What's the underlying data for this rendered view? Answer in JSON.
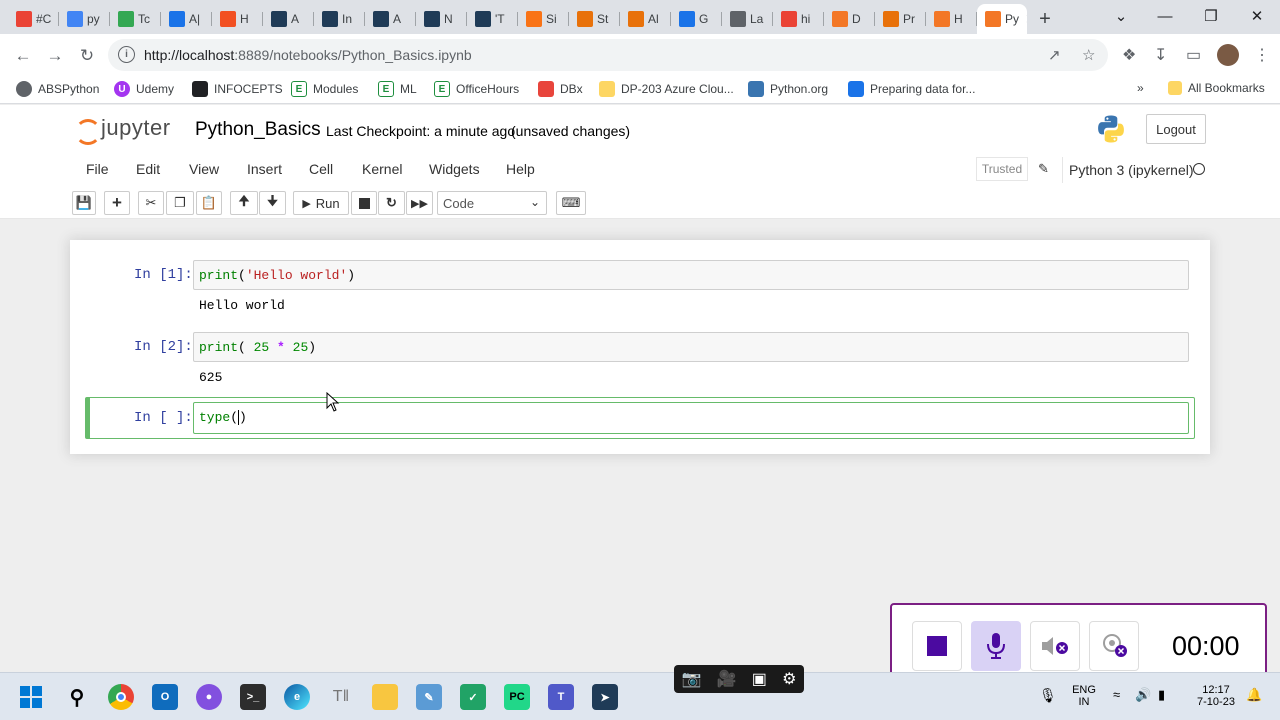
{
  "browser": {
    "tabs": [
      {
        "label": "#C",
        "icon": "gmail-icon",
        "color": "#ea4335"
      },
      {
        "label": "py",
        "icon": "google-icon",
        "color": "#4285f4"
      },
      {
        "label": "Tc",
        "icon": "drive-icon",
        "color": "#34a853"
      },
      {
        "label": "A|",
        "icon": "k-icon",
        "color": "#1a73e8"
      },
      {
        "label": "H",
        "icon": "windows-icon",
        "color": "#f25022"
      },
      {
        "label": "A",
        "icon": "tds-icon",
        "color": "#1f3b57"
      },
      {
        "label": "In",
        "icon": "tds-icon",
        "color": "#1f3b57"
      },
      {
        "label": "A",
        "icon": "tds-icon",
        "color": "#1f3b57"
      },
      {
        "label": "N",
        "icon": "tds-icon",
        "color": "#1f3b57"
      },
      {
        "label": "'T",
        "icon": "tds-icon",
        "color": "#1f3b57"
      },
      {
        "label": "Si",
        "icon": "box-icon",
        "color": "#f97316"
      },
      {
        "label": "St",
        "icon": "chevron-icon",
        "color": "#e8710a"
      },
      {
        "label": "Al",
        "icon": "chevron-icon",
        "color": "#e8710a"
      },
      {
        "label": "G",
        "icon": "calendar-icon",
        "color": "#1a73e8"
      },
      {
        "label": "La",
        "icon": "globe-icon",
        "color": "#5f6368"
      },
      {
        "label": "hi",
        "icon": "gmail-icon",
        "color": "#ea4335"
      },
      {
        "label": "D",
        "icon": "jupyter-icon",
        "color": "#f37726"
      },
      {
        "label": "Pr",
        "icon": "book-icon",
        "color": "#e8710a"
      },
      {
        "label": "H",
        "icon": "jupyter-icon",
        "color": "#f37726"
      },
      {
        "label": "Py",
        "icon": "jupyter-icon",
        "color": "#f37726",
        "active": true
      }
    ],
    "url_host": "http://localhost",
    "url_rest": ":8889/notebooks/Python_Basics.ipynb",
    "bookmarks": [
      {
        "label": "ABSPython",
        "icon": "globe-icon"
      },
      {
        "label": "Udemy",
        "icon": "udemy-icon"
      },
      {
        "label": "INFOCEPTS",
        "icon": "infocepts-icon"
      },
      {
        "label": "Modules",
        "icon": "e-icon"
      },
      {
        "label": "ML",
        "icon": "e-icon"
      },
      {
        "label": "OfficeHours",
        "icon": "e-icon"
      },
      {
        "label": "DBx",
        "icon": "layers-icon"
      },
      {
        "label": "DP-203 Azure Clou...",
        "icon": "folder-icon"
      },
      {
        "label": "Python.org",
        "icon": "python-icon"
      },
      {
        "label": "Preparing data for...",
        "icon": "play-icon"
      }
    ],
    "more_bookmarks": "»",
    "all_bookmarks": "All Bookmarks"
  },
  "jupyter": {
    "logo_text": "jupyter",
    "notebook_name": "Python_Basics",
    "checkpoint": "Last Checkpoint: a minute ago",
    "unsaved": "(unsaved changes)",
    "logout": "Logout",
    "menus": [
      "File",
      "Edit",
      "View",
      "Insert",
      "Cell",
      "Kernel",
      "Widgets",
      "Help"
    ],
    "trusted": "Trusted",
    "kernel": "Python 3 (ipykernel)",
    "run_label": "Run",
    "cell_type": "Code"
  },
  "cells": [
    {
      "prompt": "In [1]:",
      "output": "Hello world"
    },
    {
      "prompt": "In [2]:",
      "output": "625"
    },
    {
      "prompt": "In [ ]:"
    }
  ],
  "recorder": {
    "time": "00:00",
    "accent": "#7b1f83"
  },
  "taskbar": {
    "lang_top": "ENG",
    "lang_bottom": "IN",
    "time": "12:17",
    "date": "7-10-23"
  }
}
